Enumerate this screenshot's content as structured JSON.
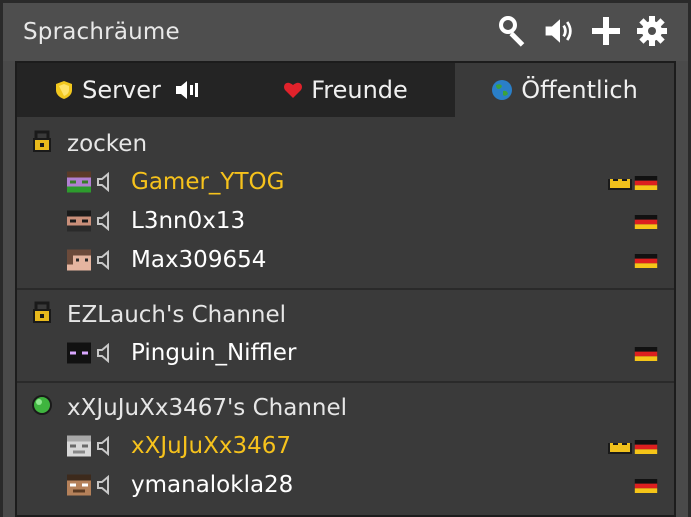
{
  "window": {
    "title": "Sprachräume"
  },
  "toolbar": {
    "icons": [
      "search-icon",
      "volume-icon",
      "add-icon",
      "settings-icon"
    ]
  },
  "tabs": [
    {
      "label": "Server",
      "icon": "gold-shield-icon",
      "active": false
    },
    {
      "label": "Freunde",
      "icon": "heart-icon",
      "active": false
    },
    {
      "label": "Öffentlich",
      "icon": "globe-icon",
      "active": true
    }
  ],
  "channels": [
    {
      "name": "zocken",
      "icon": "lock-icon",
      "members": [
        {
          "name": "Gamer_YTOG",
          "owner": true,
          "flag": "de"
        },
        {
          "name": "L3nn0x13",
          "owner": false,
          "flag": "de"
        },
        {
          "name": "Max309654",
          "owner": false,
          "flag": "de"
        }
      ]
    },
    {
      "name": "EZLauch's Channel",
      "icon": "lock-icon",
      "members": [
        {
          "name": "Pinguin_Niffler",
          "owner": false,
          "flag": "de"
        }
      ]
    },
    {
      "name": "xXJuJuXx3467's Channel",
      "icon": "green-orb-icon",
      "members": [
        {
          "name": "xXJuJuXx3467",
          "owner": true,
          "flag": "de"
        },
        {
          "name": "ymanalokla28",
          "owner": false,
          "flag": "de"
        }
      ]
    }
  ],
  "colors": {
    "owner_name": "#f6c21c",
    "background": "#3a3a3a",
    "tab_inactive": "#242424"
  }
}
